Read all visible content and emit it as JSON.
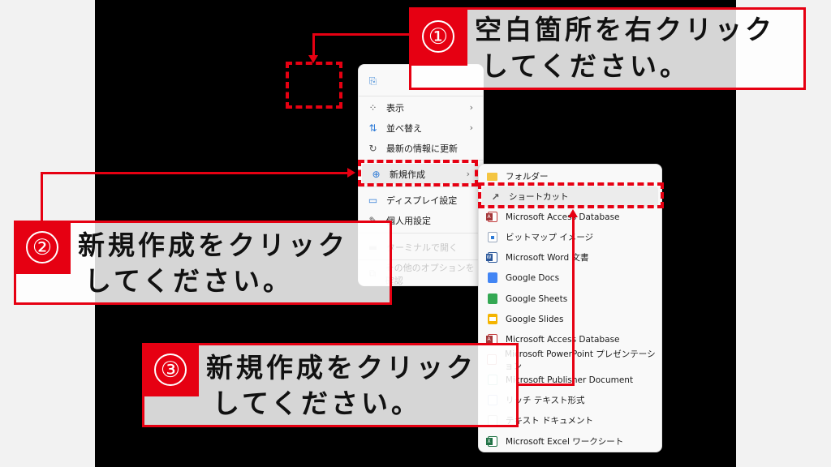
{
  "main_menu": {
    "items": [
      {
        "icon": "paste-icon",
        "label": ""
      },
      {
        "icon": "view-grid-icon",
        "label": "表示",
        "submenu": true
      },
      {
        "icon": "sort-icon",
        "label": "並べ替え",
        "submenu": true
      },
      {
        "icon": "refresh-icon",
        "label": "最新の情報に更新"
      },
      {
        "icon": "new-plus-icon",
        "label": "新規作成",
        "submenu": true
      },
      {
        "icon": "display-settings-icon",
        "label": "ディスプレイ設定"
      },
      {
        "icon": "personalize-icon",
        "label": "個人用設定"
      },
      {
        "icon": "terminal-icon",
        "label": "ターミナルで開く"
      },
      {
        "icon": "more-options-icon",
        "label": "その他のオプションを確認"
      }
    ],
    "chevron": "›"
  },
  "sub_menu": {
    "items": [
      {
        "icon": "folder-icon",
        "label": "フォルダー"
      },
      {
        "icon": "shortcut-icon",
        "label": "ショートカット"
      },
      {
        "icon": "access-icon",
        "label": "Microsoft Access Database"
      },
      {
        "icon": "bitmap-icon",
        "label": "ビットマップ イメージ"
      },
      {
        "icon": "word-icon",
        "label": "Microsoft Word 文書"
      },
      {
        "icon": "google-docs-icon",
        "label": "Google Docs"
      },
      {
        "icon": "google-sheets-icon",
        "label": "Google Sheets"
      },
      {
        "icon": "google-slides-icon",
        "label": "Google Slides"
      },
      {
        "icon": "access-icon",
        "label": "Microsoft Access Database"
      },
      {
        "icon": "powerpoint-icon",
        "label": "Microsoft PowerPoint プレゼンテーション"
      },
      {
        "icon": "publisher-icon",
        "label": "Microsoft Publisher Document"
      },
      {
        "icon": "rich-text-icon",
        "label": "リッチ テキスト形式"
      },
      {
        "icon": "text-document-icon",
        "label": "テキスト ドキュメント"
      },
      {
        "icon": "excel-icon",
        "label": "Microsoft Excel ワークシート"
      }
    ]
  },
  "callouts": [
    {
      "number": "①",
      "line1": "空白箇所を右クリック",
      "line2": "してください。"
    },
    {
      "number": "②",
      "line1": "新規作成をクリック",
      "line2": "してください。"
    },
    {
      "number": "③",
      "line1": "新規作成をクリック",
      "line2": "してください。"
    }
  ],
  "colors": {
    "accent_red": "#e60012"
  }
}
